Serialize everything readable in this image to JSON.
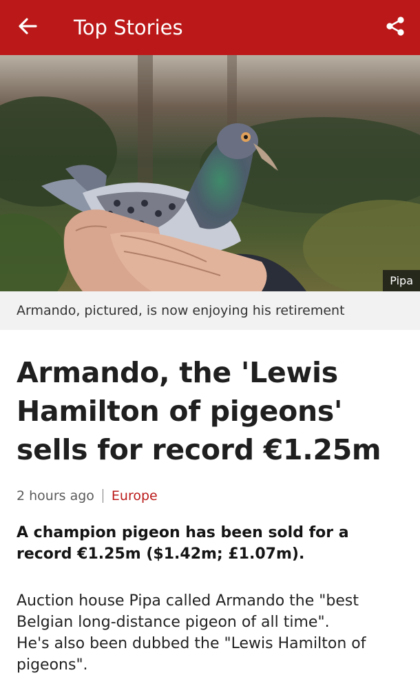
{
  "colors": {
    "brand_red": "#bb1919",
    "caption_bg": "#f2f2f2",
    "link_red": "#bb1919"
  },
  "topbar": {
    "back_icon": "arrow-left-icon",
    "title": "Top Stories",
    "share_icon": "share-icon"
  },
  "hero": {
    "image_subject": "pigeon held in two hands outdoors",
    "credit": "Pipa"
  },
  "caption": "Armando, pictured, is now enjoying his retirement",
  "article": {
    "headline": "Armando, the 'Lewis Hamilton of pigeons' sells for record €1.25m",
    "time": "2 hours ago",
    "section": "Europe",
    "intro": "A champion pigeon has been sold for a record €1.25m ($1.42m; £1.07m).",
    "body_line1": "Auction house Pipa called Armando the \"best Belgian long-distance pigeon of all time\".",
    "body_line2": "He's also been dubbed the \"Lewis Hamilton of pigeons\"."
  }
}
